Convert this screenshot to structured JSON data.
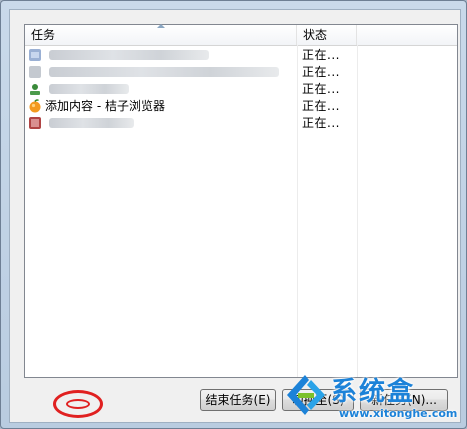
{
  "list": {
    "columns": {
      "task": "任务",
      "status": "状态"
    },
    "rows": [
      {
        "task": "",
        "status": "正在..."
      },
      {
        "task": "",
        "status": "正在..."
      },
      {
        "task": "",
        "status": "正在..."
      },
      {
        "task": "添加内容 - 桔子浏览器",
        "status": "正在..."
      },
      {
        "task": "",
        "status": "正在..."
      }
    ]
  },
  "buttons": {
    "end_task": "结束任务(E)",
    "switch_to": "切换至(S)",
    "new_task": "新任务(N)..."
  },
  "watermark": {
    "title": "系统盒",
    "url": "www.xitonghe.com"
  },
  "colors": {
    "accent": "#1c82d8",
    "highlight": "#e02020"
  }
}
